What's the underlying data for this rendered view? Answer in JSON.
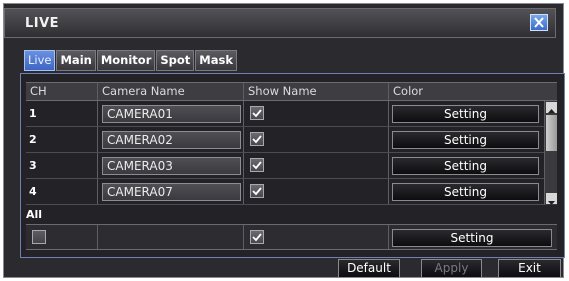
{
  "window": {
    "title": "LIVE",
    "close_icon": "close-icon"
  },
  "tabs": [
    {
      "label": "Live",
      "active": true
    },
    {
      "label": "Main"
    },
    {
      "label": "Monitor"
    },
    {
      "label": "Spot"
    },
    {
      "label": "Mask"
    }
  ],
  "table": {
    "headers": {
      "ch": "CH",
      "name": "Camera Name",
      "show": "Show Name",
      "color": "Color"
    },
    "rows": [
      {
        "ch": "1",
        "name": "CAMERA01",
        "show": true,
        "color_btn": "Setting"
      },
      {
        "ch": "2",
        "name": "CAMERA02",
        "show": true,
        "color_btn": "Setting"
      },
      {
        "ch": "3",
        "name": "CAMERA03",
        "show": true,
        "color_btn": "Setting"
      },
      {
        "ch": "4",
        "name": "CAMERA07",
        "show": true,
        "color_btn": "Setting"
      }
    ]
  },
  "all_row": {
    "label": "All",
    "select_checked": false,
    "show": true,
    "color_btn": "Setting"
  },
  "footer": {
    "default": "Default",
    "apply": "Apply",
    "exit": "Exit"
  }
}
